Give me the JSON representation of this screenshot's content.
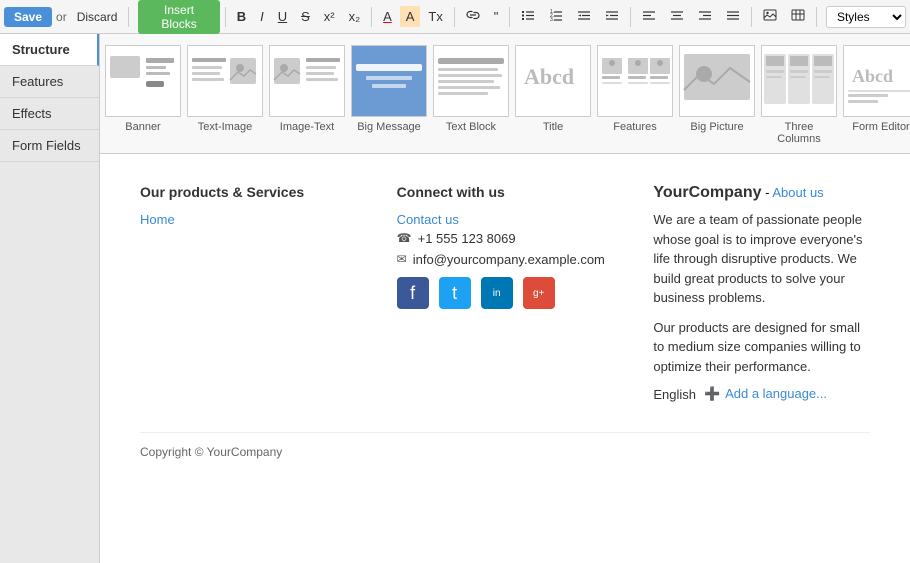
{
  "toolbar": {
    "save_label": "Save",
    "or_text": "or",
    "discard_label": "Discard",
    "insert_blocks_label": "Insert Blocks",
    "bold_label": "B",
    "italic_label": "I",
    "underline_label": "U",
    "strike_label": "S",
    "superscript_label": "x²",
    "subscript_label": "x₂",
    "font_color_label": "A",
    "bg_color_label": "A",
    "clear_format_label": "Tx",
    "list_ul_label": "≡",
    "list_ol_label": "≡",
    "indent_label": "⇥",
    "outdent_label": "⇤",
    "align_left": "≡",
    "align_center": "≡",
    "align_right": "≡",
    "align_justify": "≡",
    "link_label": "🔗",
    "quote_label": "\"",
    "image_label": "🖼",
    "table_label": "▦",
    "styles_placeholder": "Styles"
  },
  "sidebar": {
    "items": [
      {
        "id": "structure",
        "label": "Structure",
        "active": true
      },
      {
        "id": "features",
        "label": "Features",
        "active": false
      },
      {
        "id": "effects",
        "label": "Effects",
        "active": false
      },
      {
        "id": "form-fields",
        "label": "Form Fields",
        "active": false
      }
    ]
  },
  "blocks": [
    {
      "id": "banner",
      "label": "Banner"
    },
    {
      "id": "text-image",
      "label": "Text-Image"
    },
    {
      "id": "image-text",
      "label": "Image-Text"
    },
    {
      "id": "big-message",
      "label": "Big Message"
    },
    {
      "id": "text-block",
      "label": "Text Block"
    },
    {
      "id": "title",
      "label": "Title"
    },
    {
      "id": "features",
      "label": "Features"
    },
    {
      "id": "big-picture",
      "label": "Big Picture"
    },
    {
      "id": "three-columns",
      "label": "Three Columns"
    },
    {
      "id": "form-editor",
      "label": "Form Editor"
    }
  ],
  "footer": {
    "col1": {
      "heading": "Our products & Services",
      "links": [
        {
          "label": "Home",
          "href": "#"
        }
      ]
    },
    "col2": {
      "heading": "Connect with us",
      "contact_link": "Contact us",
      "phone_icon": "☎",
      "phone": "+1 555 123 8069",
      "email_icon": "✉",
      "email": "info@yourcompany.example.com",
      "social": [
        {
          "id": "facebook",
          "char": "f",
          "class": "si-fb"
        },
        {
          "id": "twitter",
          "char": "t",
          "class": "si-tw"
        },
        {
          "id": "linkedin",
          "char": "in",
          "class": "si-li"
        },
        {
          "id": "google-plus",
          "char": "g+",
          "class": "si-gp"
        }
      ]
    },
    "col3": {
      "company_name": "YourCompany",
      "dash": " - ",
      "about_link": "About us",
      "desc1": "We are a team of passionate people whose goal is to improve everyone's life through disruptive products. We build great products to solve your business problems.",
      "desc2": "Our products are designed for small to medium size companies willing to optimize their performance.",
      "lang_label": "English",
      "add_lang_label": "➕ Add a language..."
    },
    "copyright": "Copyright © YourCompany"
  }
}
